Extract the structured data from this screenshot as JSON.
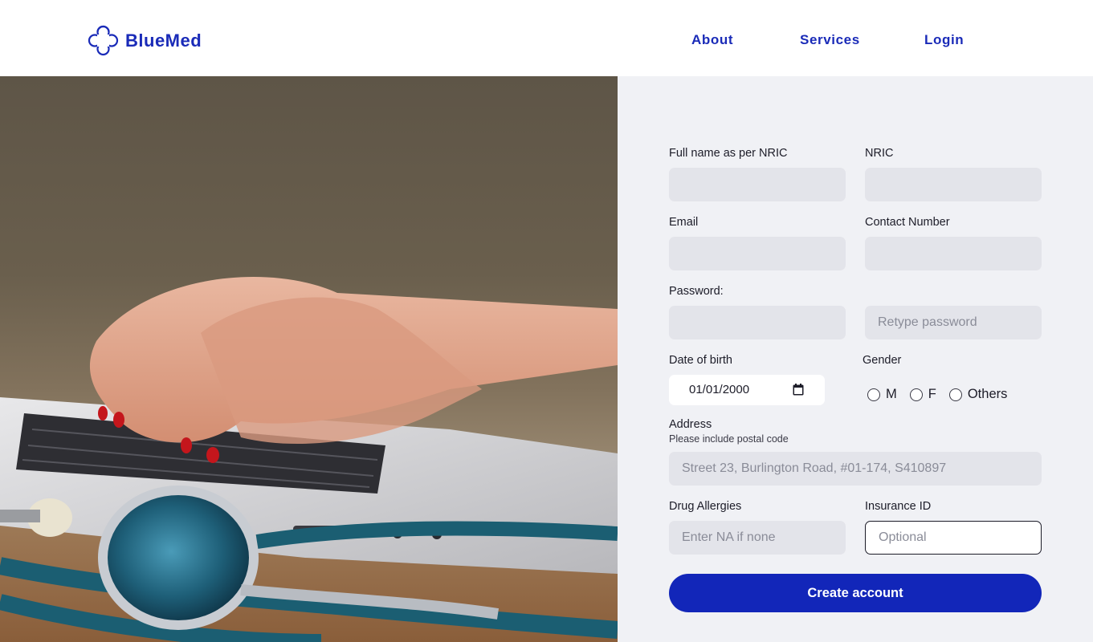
{
  "brand": {
    "name": "BlueMed",
    "color": "#1a2bb8",
    "logo_icon": "medical-cross-icon"
  },
  "nav": [
    {
      "label": "About"
    },
    {
      "label": "Services"
    },
    {
      "label": "Login"
    }
  ],
  "hero": {
    "icon": "laptop-stethoscope-photo"
  },
  "form": {
    "full_name": {
      "label": "Full name as per NRIC",
      "placeholder": ""
    },
    "nric": {
      "label": "NRIC",
      "placeholder": ""
    },
    "email": {
      "label": "Email",
      "placeholder": ""
    },
    "contact": {
      "label": "Contact Number",
      "placeholder": ""
    },
    "password": {
      "label": "Password:",
      "placeholder": ""
    },
    "retype": {
      "placeholder": "Retype password"
    },
    "dob": {
      "label": "Date of birth",
      "value": "01/01/2000",
      "icon": "calendar-icon"
    },
    "gender": {
      "label": "Gender",
      "options": [
        "M",
        "F",
        "Others"
      ]
    },
    "address": {
      "label": "Address",
      "hint": "Please include postal code",
      "placeholder": "Street 23, Burlington Road, #01-174, S410897"
    },
    "allergies": {
      "label": "Drug Allergies",
      "placeholder": "Enter NA if none"
    },
    "insurance": {
      "label": "Insurance ID",
      "placeholder": "Optional"
    },
    "submit_label": "Create account"
  },
  "colors": {
    "accent": "#1226b9",
    "panel_bg": "#f0f1f5",
    "field_bg": "#e3e4ea"
  }
}
